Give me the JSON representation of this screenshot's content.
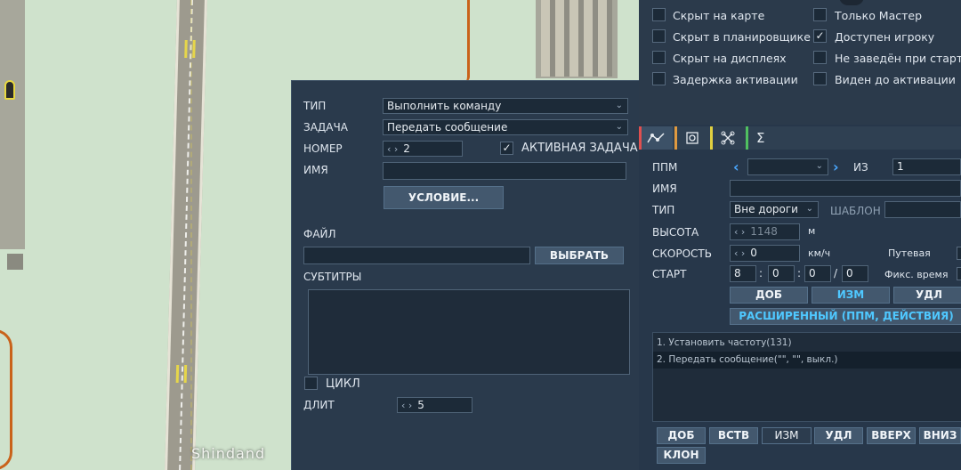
{
  "map": {
    "label": "Shindand"
  },
  "flags": [
    {
      "label": "Скрыт на карте",
      "checked": ""
    },
    {
      "label": "Только Мастер",
      "checked": ""
    },
    {
      "label": "Скрыт в планировщике",
      "checked": ""
    },
    {
      "label": "Доступен игроку",
      "checked": "✓"
    },
    {
      "label": "Скрыт на дисплеях",
      "checked": ""
    },
    {
      "label": "Не заведён при старте",
      "checked": ""
    },
    {
      "label": "Задержка активации",
      "checked": ""
    },
    {
      "label": "Виден до активации",
      "checked": ""
    }
  ],
  "trigger": {
    "type_label": "ТИП",
    "type_value": "Выполнить команду",
    "task_label": "ЗАДАЧА",
    "task_value": "Передать сообщение",
    "number_label": "НОМЕР",
    "number_value": "2",
    "active_label": "АКТИВНАЯ ЗАДАЧА",
    "active_checked": "✓",
    "name_label": "ИМЯ",
    "name_value": "",
    "condition_button": "УСЛОВИЕ...",
    "file_label": "ФАЙЛ",
    "file_value": "",
    "choose_button": "ВЫБРАТЬ",
    "subtitles_label": "СУБТИТРЫ",
    "subtitles_value": "",
    "loop_label": "ЦИКЛ",
    "loop_checked": "",
    "duration_label": "ДЛИТ",
    "duration_value": "5"
  },
  "tabs": {
    "tab_colors": [
      "#e05050",
      "#e09a40",
      "#e0d040",
      "#50c060"
    ],
    "icons": [
      "waypoint-icon",
      "target-icon",
      "drone-icon",
      "sum-icon"
    ],
    "sigma": "Σ"
  },
  "route": {
    "wp_label": "ППМ",
    "wp_value": "",
    "of_label": "ИЗ",
    "of_value": "1",
    "name_label": "ИМЯ",
    "name_value": "",
    "type_label": "ТИП",
    "type_value": "Вне дороги",
    "template_label": "ШАБЛОН",
    "template_value": "",
    "alt_label": "ВЫСОТА",
    "alt_value": "1148",
    "alt_unit": "м",
    "speed_label": "СКОРОСТЬ",
    "speed_value": "0",
    "speed_unit": "км/ч",
    "track_label": "Путевая",
    "start_label": "СТАРТ",
    "start_h": "8",
    "start_m": "0",
    "start_s": "0",
    "start_d": "0",
    "sep_colon": ":",
    "sep_slash": "/",
    "fixed_time_label": "Фикс. время",
    "add_button": "ДОБ",
    "edit_button": "ИЗМ",
    "del_button": "УДЛ",
    "advanced_button": "РАСШИРЕННЫЙ (ППМ, ДЕЙСТВИЯ)",
    "actions": [
      "1. Установить частоту(131)",
      "2. Передать сообщение(\"\", \"\", выкл.)"
    ],
    "bottom_buttons": [
      "ДОБ",
      "ВСТВ",
      "ИЗМ",
      "УДЛ",
      "ВВЕРХ",
      "ВНИЗ",
      "КЛОН"
    ]
  }
}
